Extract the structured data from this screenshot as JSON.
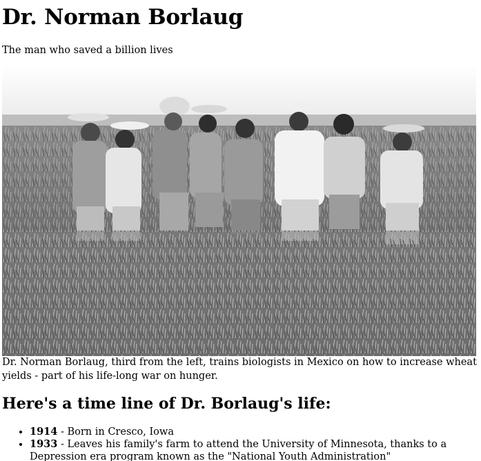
{
  "page": {
    "title": "Dr. Norman Borlaug",
    "subtitle": "The man who saved a billion lives"
  },
  "photo": {
    "caption": "Dr. Norman Borlaug, third from the left, trains biologists in Mexico on how to increase wheat yields - part of his life-long war on hunger."
  },
  "timeline": {
    "heading": "Here's a time line of Dr. Borlaug's life:",
    "separator": " - ",
    "items": [
      {
        "year": "1914",
        "text": "Born in Cresco, Iowa"
      },
      {
        "year": "1933",
        "text": "Leaves his family's farm to attend the University of Minnesota, thanks to a Depression era program known as the \"National Youth Administration\""
      }
    ]
  },
  "colors": {
    "text": "#000000",
    "background": "#ffffff",
    "sky": "#f5f5f5",
    "field": "#7a7a7a"
  }
}
